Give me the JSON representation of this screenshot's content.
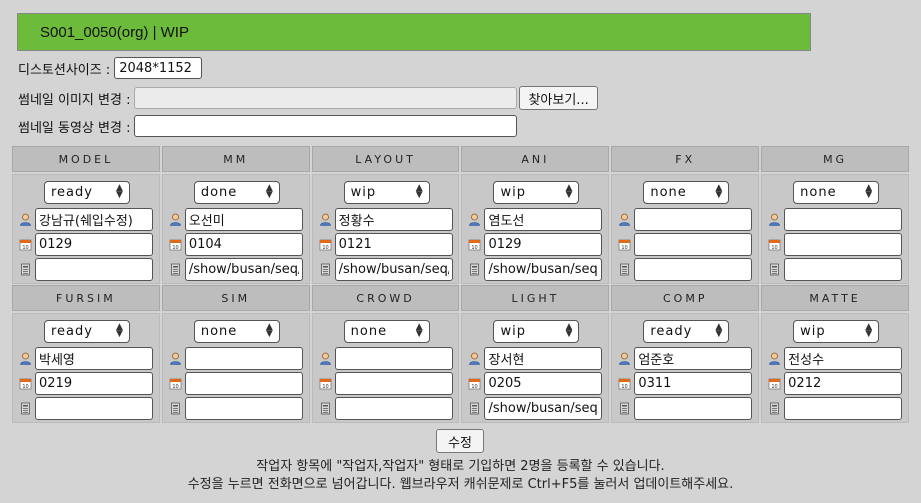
{
  "header": {
    "title": "S001_0050(org) | WIP"
  },
  "form": {
    "distortion_label": "디스토션사이즈 :",
    "distortion_value": "2048*1152",
    "thumb_image_label": "썸네일 이미지 변경 :",
    "browse_label": "찾아보기...",
    "thumb_video_label": "썸네일 동영상 변경 :"
  },
  "departments": [
    {
      "name": "MODEL",
      "status": "ready",
      "worker": "강남규(쉐입수정)",
      "date": "0129",
      "path": ""
    },
    {
      "name": "MM",
      "status": "done",
      "worker": "오선미",
      "date": "0104",
      "path": "/show/busan/seq/s"
    },
    {
      "name": "LAYOUT",
      "status": "wip",
      "worker": "정황수",
      "date": "0121",
      "path": "/show/busan/seq/s"
    },
    {
      "name": "ANI",
      "status": "wip",
      "worker": "염도선",
      "date": "0129",
      "path": "/show/busan/seq/s"
    },
    {
      "name": "FX",
      "status": "none",
      "worker": "",
      "date": "",
      "path": ""
    },
    {
      "name": "MG",
      "status": "none",
      "worker": "",
      "date": "",
      "path": ""
    },
    {
      "name": "FURSIM",
      "status": "ready",
      "worker": "박세영",
      "date": "0219",
      "path": ""
    },
    {
      "name": "SIM",
      "status": "none",
      "worker": "",
      "date": "",
      "path": ""
    },
    {
      "name": "CROWD",
      "status": "none",
      "worker": "",
      "date": "",
      "path": ""
    },
    {
      "name": "LIGHT",
      "status": "wip",
      "worker": "장서현",
      "date": "0205",
      "path": "/show/busan/seq/s"
    },
    {
      "name": "COMP",
      "status": "ready",
      "worker": "엄준호",
      "date": "0311",
      "path": ""
    },
    {
      "name": "MATTE",
      "status": "wip",
      "worker": "전성수",
      "date": "0212",
      "path": ""
    }
  ],
  "icons": {
    "worker": "person-icon",
    "date": "calendar-icon",
    "path": "document-icon"
  },
  "footer": {
    "submit_label": "수정",
    "note1": "작업자 항목에 \"작업자,작업자\" 형태로 기입하면 2명을 등록할 수 있습니다.",
    "note2": "수정을 누르면 전화면으로 넘어갑니다. 웹브라우저 캐쉬문제로 Ctrl+F5를 눌러서 업데이트해주세요."
  }
}
